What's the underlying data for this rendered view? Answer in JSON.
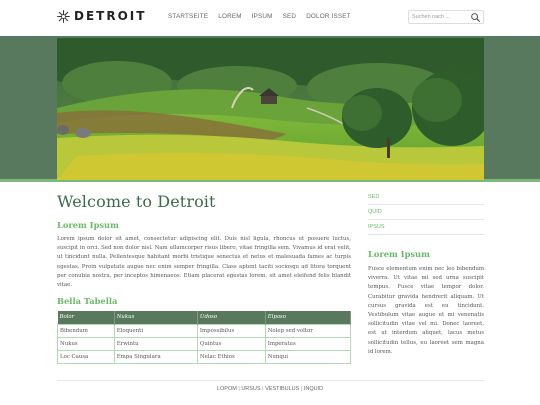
{
  "header": {
    "logo_text": "DETROIT",
    "nav": [
      "STARTSEITE",
      "LOREM",
      "IPSUM",
      "SED",
      "DOLOR ISSET"
    ],
    "search_placeholder": "Suchen nach ..."
  },
  "banner": {
    "icon": "landscape-photo"
  },
  "main": {
    "title": "Welcome to Detroit",
    "section1_heading": "Lorem Ipsum",
    "section1_text": "Lorem ipsum dolor sit amet, consectetur adipiscing elit. Duis nisl ligula, rhoncus et posuere luctus, suscipit in orci. Sed non dolor nisl. Nam ullamcorper risus libero, vitae fringilla sem. Vivamus id erat velit, ut tincidunt nulla. Pellentesque habitant morbi tristique senectus et netus et malesuada fames ac turpis egestas. Proin vulputate augue nec enim semper fringilla. Class aptent taciti sociosqu ad litora torquent per conubia nostra, per inceptos himenaeos. Etiam placerat egestas lorem, sit amet eleifend felis blandit vitae.",
    "table_heading": "Bella Tabella",
    "table": {
      "headers": [
        "Bolor",
        "Nukus",
        "Udoso",
        "Elpaso"
      ],
      "rows": [
        [
          "Bibendum",
          "Eloquenti",
          "Impossibilus",
          "Nolep sed voltor"
        ],
        [
          "Nukus",
          "Erwintu",
          "Quintus",
          "Imperatus"
        ],
        [
          "Loc Causa",
          "Empa Singulara",
          "Nelac Ethios",
          "Nunqui"
        ]
      ]
    }
  },
  "sidebar": {
    "links": [
      "SED",
      "QUID",
      "IPSUS"
    ],
    "heading": "Lorem Ipsum",
    "text": "Fusce elementum enim nec leo bibendum viverra. Ut vitae mi sed urna suscipit tempus. Fusce vitae tempor dolor. Curabitur gravida hendrerit aliquam. Ut cursus gravida est eu tincidunt. Vestibulum vitae augue et mi venenatis sollicitudin vitae vel mi. Donec laoreet, est ut interdum aliquet, lacus metus sollicitudin tellus, eu laoreet sem magna id lorem."
  },
  "footer": {
    "links": [
      "LOPOM",
      "URSUS",
      "VESTIBULUS",
      "INQUID"
    ]
  },
  "colors": {
    "accent_green": "#6bb86b",
    "dark_green": "#58795e",
    "title_green": "#3a6b49"
  }
}
